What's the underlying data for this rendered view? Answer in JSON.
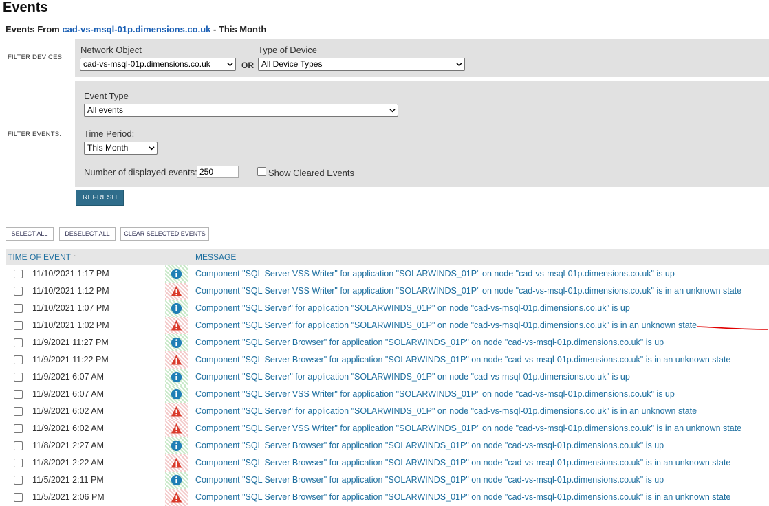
{
  "page": {
    "title": "Events",
    "subtitle_prefix": "Events From",
    "subtitle_node": "cad-vs-msql-01p.dimensions.co.uk",
    "subtitle_suffix": "- This Month"
  },
  "filter_devices": {
    "label": "FILTER DEVICES:",
    "network_object_label": "Network Object",
    "network_object_value": "cad-vs-msql-01p.dimensions.co.uk",
    "or_label": "OR",
    "device_type_label": "Type of Device",
    "device_type_value": "All Device Types"
  },
  "filter_events": {
    "label": "FILTER EVENTS:",
    "event_type_label": "Event Type",
    "event_type_value": "All events",
    "time_period_label": "Time Period:",
    "time_period_value": "This Month",
    "num_events_label": "Number of displayed events:",
    "num_events_value": "250",
    "show_cleared_label": "Show Cleared Events",
    "show_cleared_checked": false
  },
  "buttons": {
    "refresh": "REFRESH",
    "select_all": "SELECT ALL",
    "deselect_all": "DESELECT ALL",
    "clear_selected": "CLEAR SELECTED EVENTS"
  },
  "table": {
    "col_time": "TIME OF EVENT",
    "col_message": "MESSAGE",
    "rows": [
      {
        "time": "11/10/2021 1:17 PM",
        "status": "up",
        "message": "Component \"SQL Server VSS Writer\" for application \"SOLARWINDS_01P\" on node \"cad-vs-msql-01p.dimensions.co.uk\" is up"
      },
      {
        "time": "11/10/2021 1:12 PM",
        "status": "unknown",
        "message": "Component \"SQL Server VSS Writer\" for application \"SOLARWINDS_01P\" on node \"cad-vs-msql-01p.dimensions.co.uk\" is in an unknown state"
      },
      {
        "time": "11/10/2021 1:07 PM",
        "status": "up",
        "message": "Component \"SQL Server\" for application \"SOLARWINDS_01P\" on node \"cad-vs-msql-01p.dimensions.co.uk\" is up"
      },
      {
        "time": "11/10/2021 1:02 PM",
        "status": "unknown",
        "message": "Component \"SQL Server\" for application \"SOLARWINDS_01P\" on node \"cad-vs-msql-01p.dimensions.co.uk\" is in an unknown state"
      },
      {
        "time": "11/9/2021 11:27 PM",
        "status": "up",
        "message": "Component \"SQL Server Browser\" for application \"SOLARWINDS_01P\" on node \"cad-vs-msql-01p.dimensions.co.uk\" is up"
      },
      {
        "time": "11/9/2021 11:22 PM",
        "status": "unknown",
        "message": "Component \"SQL Server Browser\" for application \"SOLARWINDS_01P\" on node \"cad-vs-msql-01p.dimensions.co.uk\" is in an unknown state"
      },
      {
        "time": "11/9/2021 6:07 AM",
        "status": "up",
        "message": "Component \"SQL Server\" for application \"SOLARWINDS_01P\" on node \"cad-vs-msql-01p.dimensions.co.uk\" is up"
      },
      {
        "time": "11/9/2021 6:07 AM",
        "status": "up",
        "message": "Component \"SQL Server VSS Writer\" for application \"SOLARWINDS_01P\" on node \"cad-vs-msql-01p.dimensions.co.uk\" is up"
      },
      {
        "time": "11/9/2021 6:02 AM",
        "status": "unknown",
        "message": "Component \"SQL Server\" for application \"SOLARWINDS_01P\" on node \"cad-vs-msql-01p.dimensions.co.uk\" is in an unknown state"
      },
      {
        "time": "11/9/2021 6:02 AM",
        "status": "unknown",
        "message": "Component \"SQL Server VSS Writer\" for application \"SOLARWINDS_01P\" on node \"cad-vs-msql-01p.dimensions.co.uk\" is in an unknown state"
      },
      {
        "time": "11/8/2021 2:27 AM",
        "status": "up",
        "message": "Component \"SQL Server Browser\" for application \"SOLARWINDS_01P\" on node \"cad-vs-msql-01p.dimensions.co.uk\" is up"
      },
      {
        "time": "11/8/2021 2:22 AM",
        "status": "unknown",
        "message": "Component \"SQL Server Browser\" for application \"SOLARWINDS_01P\" on node \"cad-vs-msql-01p.dimensions.co.uk\" is in an unknown state"
      },
      {
        "time": "11/5/2021 2:11 PM",
        "status": "up",
        "message": "Component \"SQL Server Browser\" for application \"SOLARWINDS_01P\" on node \"cad-vs-msql-01p.dimensions.co.uk\" is up"
      },
      {
        "time": "11/5/2021 2:06 PM",
        "status": "unknown",
        "message": "Component \"SQL Server Browser\" for application \"SOLARWINDS_01P\" on node \"cad-vs-msql-01p.dimensions.co.uk\" is in an unknown state"
      }
    ]
  },
  "colors": {
    "link": "#1e6f9f",
    "accent_button": "#2f6d8b",
    "panel_bg": "#e1e1e1",
    "annotation_red": "#e00000"
  }
}
